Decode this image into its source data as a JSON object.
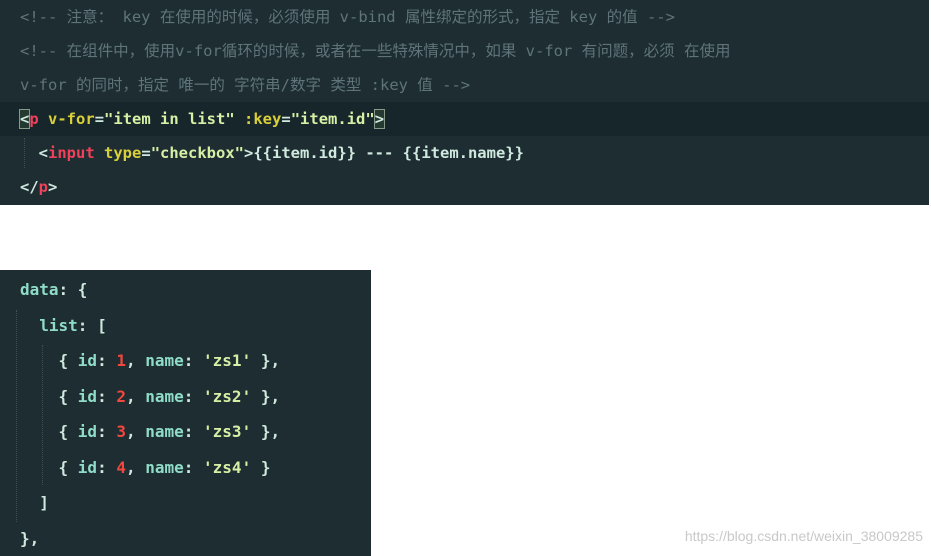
{
  "colors": {
    "background": "#1e2d31",
    "comment": "#5f7479",
    "tag": "#f0405a",
    "attribute": "#d9cf3a",
    "string": "#d6f0a6",
    "number": "#f2473f",
    "key": "#8fdcc9"
  },
  "top_code": [
    [
      [
        "cm",
        "<!-- 注意： key 在使用的时候，必须使用 v-bind 属性绑定的形式，指定 key 的值 -->"
      ]
    ],
    [
      [
        "cm",
        "<!-- 在组件中，使用v-for循环的时候，或者在一些特殊情况中，如果 v-for 有问题，必须 在使用"
      ]
    ],
    [
      [
        "cm",
        "v-for 的同时，指定 唯一的 字符串/数字 类型 :key 值 -->"
      ]
    ],
    [
      [
        "bracket",
        "<"
      ],
      [
        "tag",
        "p"
      ],
      [
        "attr",
        " v-for"
      ],
      [
        "txt",
        "="
      ],
      [
        "str",
        "\"item in list\""
      ],
      [
        "attr",
        " :key"
      ],
      [
        "txt",
        "="
      ],
      [
        "str",
        "\"item.id\""
      ],
      [
        "bracket",
        ">"
      ]
    ],
    [
      [
        "txt",
        "  <"
      ],
      [
        "tag",
        "input"
      ],
      [
        "attr",
        " type"
      ],
      [
        "txt",
        "="
      ],
      [
        "str",
        "\"checkbox\""
      ],
      [
        "txt",
        ">{{item.id}} --- {{item.name}}"
      ]
    ],
    [
      [
        "txt",
        "</"
      ],
      [
        "tag",
        "p"
      ],
      [
        "txt",
        ">"
      ]
    ]
  ],
  "bottom_code": [
    [
      [
        "key",
        "data"
      ],
      [
        "txt",
        ": {"
      ]
    ],
    [
      [
        "key",
        "  list"
      ],
      [
        "txt",
        ": ["
      ]
    ],
    [
      [
        "txt",
        "    { "
      ],
      [
        "key",
        "id"
      ],
      [
        "txt",
        ": "
      ],
      [
        "num",
        "1"
      ],
      [
        "txt",
        ", "
      ],
      [
        "key",
        "name"
      ],
      [
        "txt",
        ": "
      ],
      [
        "str",
        "'zs1'"
      ],
      [
        "txt",
        " },"
      ]
    ],
    [
      [
        "txt",
        "    { "
      ],
      [
        "key",
        "id"
      ],
      [
        "txt",
        ": "
      ],
      [
        "num",
        "2"
      ],
      [
        "txt",
        ", "
      ],
      [
        "key",
        "name"
      ],
      [
        "txt",
        ": "
      ],
      [
        "str",
        "'zs2'"
      ],
      [
        "txt",
        " },"
      ]
    ],
    [
      [
        "txt",
        "    { "
      ],
      [
        "key",
        "id"
      ],
      [
        "txt",
        ": "
      ],
      [
        "num",
        "3"
      ],
      [
        "txt",
        ", "
      ],
      [
        "key",
        "name"
      ],
      [
        "txt",
        ": "
      ],
      [
        "str",
        "'zs3'"
      ],
      [
        "txt",
        " },"
      ]
    ],
    [
      [
        "txt",
        "    { "
      ],
      [
        "key",
        "id"
      ],
      [
        "txt",
        ": "
      ],
      [
        "num",
        "4"
      ],
      [
        "txt",
        ", "
      ],
      [
        "key",
        "name"
      ],
      [
        "txt",
        ": "
      ],
      [
        "str",
        "'zs4'"
      ],
      [
        "txt",
        " }"
      ]
    ],
    [
      [
        "txt",
        "  ]"
      ]
    ],
    [
      [
        "txt",
        "},"
      ]
    ]
  ],
  "watermark": "https://blog.csdn.net/weixin_38009285"
}
